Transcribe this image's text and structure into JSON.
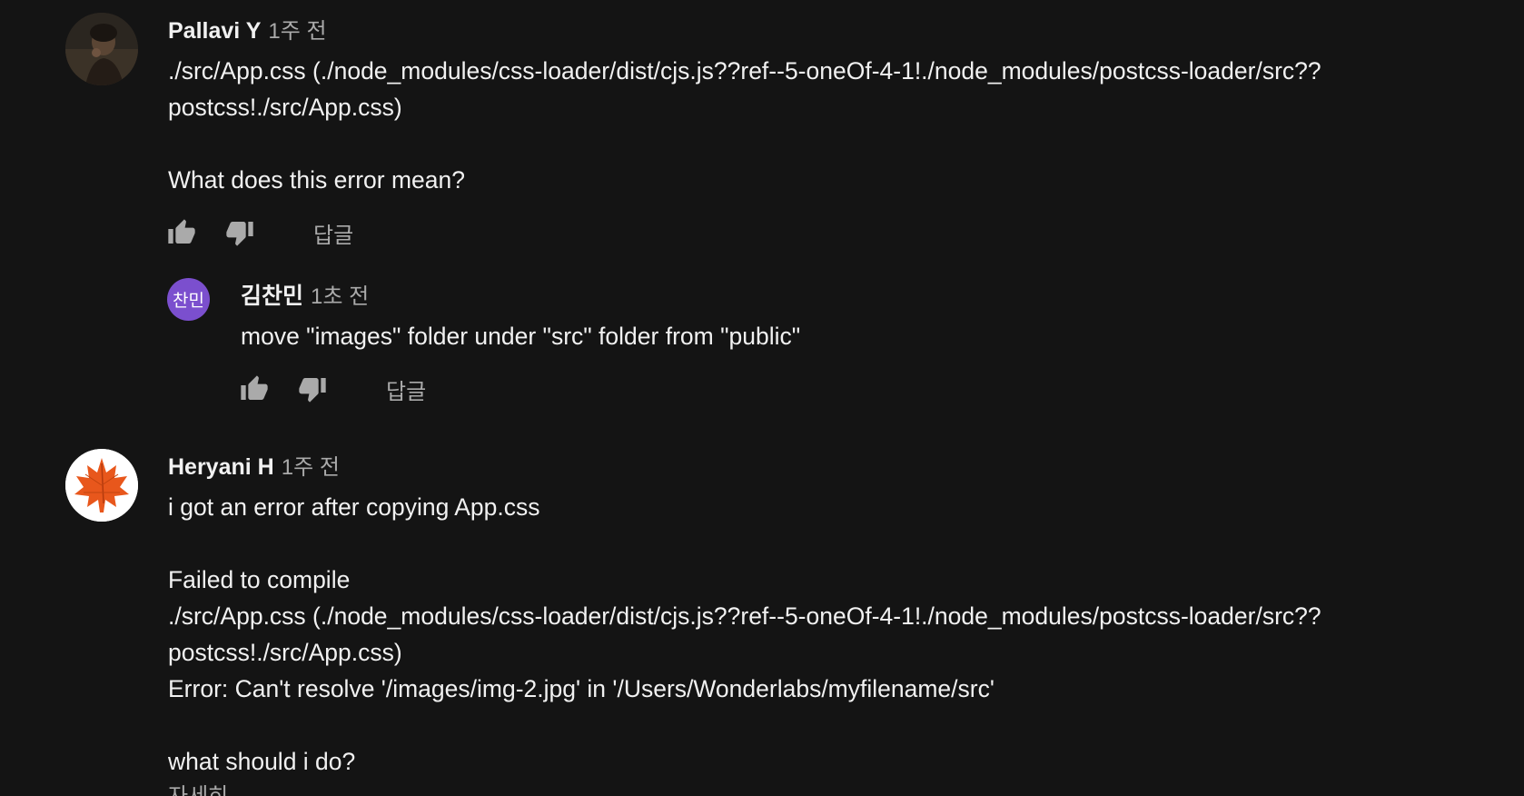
{
  "comments": [
    {
      "author": "Pallavi Y",
      "time": "1주 전",
      "text": "./src/App.css (./node_modules/css-loader/dist/cjs.js??ref--5-oneOf-4-1!./node_modules/postcss-loader/src??\npostcss!./src/App.css)\n\nWhat does this error mean?",
      "reply_label": "답글",
      "avatar_icon": "person-photo-icon"
    },
    {
      "author": "김찬민",
      "time": "1초 전",
      "avatar_text": "찬민",
      "avatar_color": "#7b4fce",
      "text": "move \"images\" folder under \"src\" folder from \"public\"",
      "reply_label": "답글"
    },
    {
      "author": "Heryani H",
      "time": "1주 전",
      "text": "i got an error after copying App.css\n\nFailed to compile\n./src/App.css (./node_modules/css-loader/dist/cjs.js??ref--5-oneOf-4-1!./node_modules/postcss-loader/src??\npostcss!./src/App.css)\nError: Can't resolve '/images/img-2.jpg' in '/Users/Wonderlabs/myfilename/src'\n\nwhat should i do?",
      "avatar_icon": "maple-leaf-icon",
      "cut_off_label": "자세히"
    }
  ],
  "colors": {
    "background": "#141414",
    "text": "#f1f1f1",
    "muted": "#aaaaaa",
    "accent": "#7b4fce"
  }
}
